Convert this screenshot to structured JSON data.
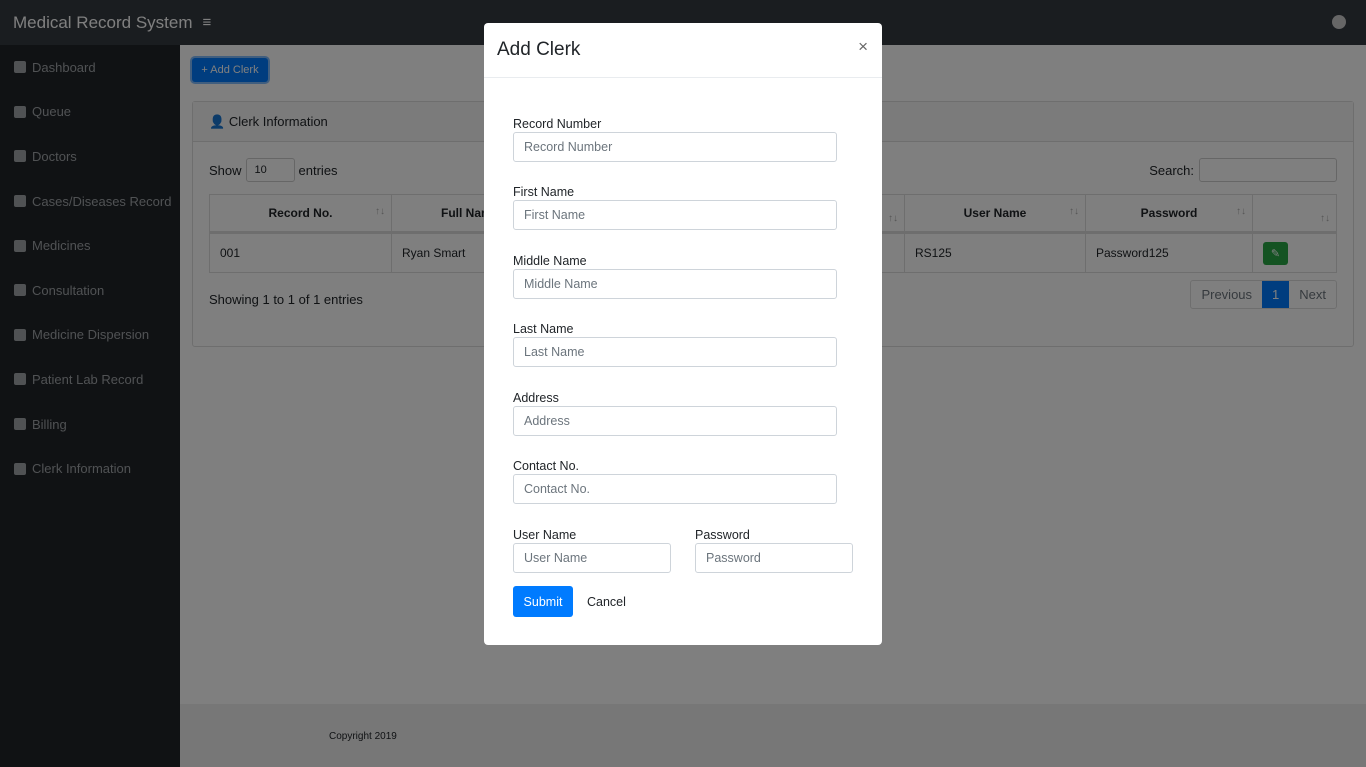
{
  "app": {
    "title": "Medical Record System"
  },
  "sidebar": {
    "items": [
      {
        "label": "Dashboard",
        "icon": "dashboard-icon"
      },
      {
        "label": "Queue",
        "icon": "hourglass-icon"
      },
      {
        "label": "Doctors",
        "icon": "doctor-icon"
      },
      {
        "label": "Cases/Diseases Record",
        "icon": "file-icon"
      },
      {
        "label": "Medicines",
        "icon": "medkit-icon"
      },
      {
        "label": "Consultation",
        "icon": "stethoscope-icon"
      },
      {
        "label": "Medicine Dispersion",
        "icon": "circle-icon"
      },
      {
        "label": "Patient Lab Record",
        "icon": "file-medical-icon"
      },
      {
        "label": "Billing",
        "icon": "billing-icon"
      },
      {
        "label": "Clerk Information",
        "icon": "user-icon"
      }
    ]
  },
  "main": {
    "add_button": "+ Add Clerk",
    "card_title": "Clerk Information",
    "show": "Show",
    "entries": "entries",
    "page_length": "10",
    "search_label": "Search:",
    "columns": [
      "Record No.",
      "Full Name",
      "User Name",
      "Password",
      ""
    ],
    "rows": [
      [
        "001",
        "Ryan Smart",
        "RS125",
        "Password125"
      ]
    ],
    "info": "Showing 1 to 1 of 1 entries",
    "pagination": {
      "previous": "Previous",
      "current": "1",
      "next": "Next"
    }
  },
  "footer": {
    "text": "Copyright 2019"
  },
  "modal": {
    "title": "Add Clerk",
    "close": "×",
    "fields": [
      {
        "label": "Record Number",
        "placeholder": "Record Number"
      },
      {
        "label": "First Name",
        "placeholder": "First Name"
      },
      {
        "label": "Middle Name",
        "placeholder": "Middle Name"
      },
      {
        "label": "Last Name",
        "placeholder": "Last Name"
      },
      {
        "label": "Address",
        "placeholder": "Address"
      },
      {
        "label": "Contact No.",
        "placeholder": "Contact No."
      },
      {
        "label": "User Name",
        "placeholder": "User Name"
      },
      {
        "label": "Password",
        "placeholder": "Password"
      }
    ],
    "submit": "Submit",
    "cancel": "Cancel"
  },
  "colors": {
    "primary": "#007bff",
    "success": "#28a745",
    "navbar": "#343a40",
    "sidebar": "#212529"
  }
}
